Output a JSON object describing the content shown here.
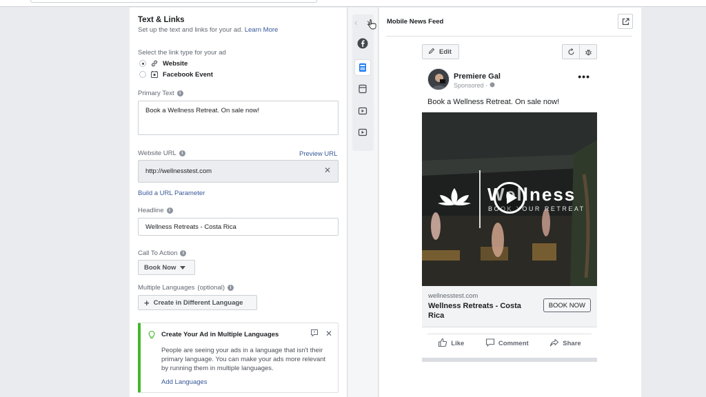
{
  "form": {
    "title": "Text & Links",
    "subtitle": "Set up the text and links for your ad.",
    "learn_more": "Learn More",
    "link_type_label": "Select the link type for your ad",
    "link_types": [
      {
        "label": "Website",
        "selected": true,
        "icon": "link-icon"
      },
      {
        "label": "Facebook Event",
        "selected": false,
        "icon": "calendar-icon"
      }
    ],
    "primary_text_label": "Primary Text",
    "primary_text_value": "Book a Wellness Retreat. On sale now!",
    "website_url_label": "Website URL",
    "preview_url": "Preview URL",
    "website_url_value": "http://wellnesstest.com",
    "clear_symbol": "✕",
    "build_url": "Build a URL Parameter",
    "headline_label": "Headline",
    "headline_value": "Wellness Retreats - Costa Rica",
    "cta_label": "Call To Action",
    "cta_value": "Book Now",
    "languages_label": "Multiple Languages",
    "languages_optional": "(optional)",
    "create_language": "Create in Different Language",
    "plus_symbol": "+"
  },
  "tip": {
    "title": "Create Your Ad in Multiple Languages",
    "body": "People are seeing your ads in a language that isn't their primary language. You can make your ads more relevant by running them in multiple languages.",
    "link": "Add Languages",
    "close_symbol": "✕"
  },
  "strip": {
    "prev_arrow": "‹",
    "next_arrow": "›",
    "icons": [
      "facebook-icon",
      "feed-icon",
      "story-icon",
      "video-icon",
      "video-alt-icon"
    ]
  },
  "preview": {
    "title": "Mobile News Feed",
    "edit": "Edit",
    "page_name": "Premiere Gal",
    "sponsored": "Sponsored ·",
    "more": "•••",
    "post_text": "Book a Wellness Retreat. On sale now!",
    "media_brand": "Wellness",
    "media_sub": "BOOK YOUR RETREAT",
    "link_domain": "wellnesstest.com",
    "link_headline": "Wellness Retreats - Costa Rica",
    "cta_button": "BOOK NOW",
    "actions": [
      "Like",
      "Comment",
      "Share"
    ]
  },
  "colors": {
    "accent": "#1877f2",
    "link": "#385898",
    "tip_bar": "#42b72a"
  }
}
